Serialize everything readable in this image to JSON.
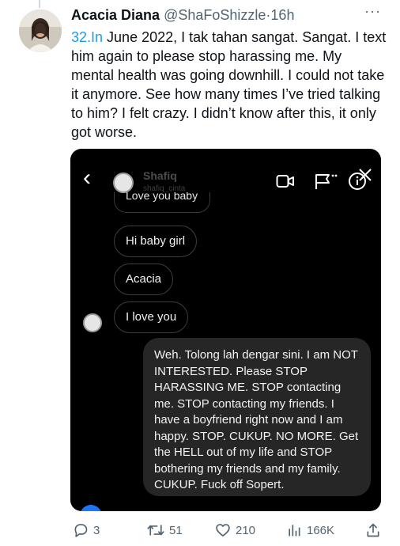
{
  "tweet": {
    "author_name": "Acacia Diana",
    "author_handle": "@ShaFoShizzle",
    "separator": "·",
    "time": "16h",
    "more_label": "···",
    "thread_prefix": "32.In",
    "text_rest": " June 2022, I tak tahan sangat. Sangat. I text him again to please stop harassing me. My mental health was going downhill. I could not take it anymore. See how many times I’ve tried talking to him? I felt crazy. I didn’t know after this, it only got worse."
  },
  "dm": {
    "contact_name": "Shafiq",
    "contact_username": "shafiq_cinta",
    "back_icon": "‹",
    "partial_message": "Love you baby",
    "messages_received": [
      "Hi baby girl",
      "Acacia",
      "I love you"
    ],
    "message_sent": "Weh. Tolong lah dengar sini. I am NOT INTERESTED. Please STOP HARASSING ME. STOP contacting me. STOP contacting my friends. I have a boyfriend right now and I am happy. STOP. CUKUP. NO MORE. Get the HELL out of my life and STOP bothering my friends and my family. CUKUP. Fuck off Sopert."
  },
  "actions": {
    "replies": "3",
    "retweets": "51",
    "likes": "210",
    "views": "166K"
  },
  "colors": {
    "link": "#1d9bf0",
    "muted": "#536471",
    "text": "#0f1419"
  }
}
